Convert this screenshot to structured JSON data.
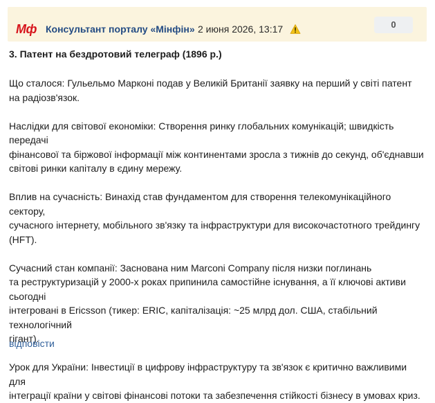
{
  "header": {
    "logo_text": "Мф",
    "author": "Консультант порталу «Мінфін»",
    "date": "2 июня 2026, 13:17",
    "counter": "0",
    "warning_icon": "warning-triangle-icon",
    "colors": {
      "header_bg": "#fbf4de",
      "logo": "#d7141c",
      "author": "#234b83",
      "warning": "#f2c219"
    }
  },
  "post": {
    "title": "3. Патент на бездротовий телеграф (1896 р.)",
    "paragraphs": [
      {
        "lines": [
          "Що сталося: Гульельмо Марконі подав у Великій Британії заявку на перший у світі патент",
          "на радіозв'язок."
        ]
      },
      {
        "lines": [
          "Наслідки для світової економіки: Створення ринку глобальних комунікацій; швидкість передачі",
          "фінансової та біржової інформації між континентами зросла з тижнів до секунд, об'єднавши",
          "світові ринки капіталу в єдину мережу."
        ]
      },
      {
        "lines": [
          "Вплив на сучасність: Винахід став фундаментом для створення телекомунікаційного сектору,",
          "сучасного інтернету, мобільного зв'язку та інфраструктури для високочастотного трейдингу",
          "(HFT)."
        ]
      },
      {
        "lines": [
          "Сучасний стан компанії: Заснована ним Marconi Company після низки поглинань",
          "та реструктуризацій у 2000-х роках припинила самостійне існування, а її ключові активи сьогодні",
          "інтегровані в Ericsson (тикер: ERIC, капіталізація: ~25 млрд дол. США, стабільний технологічний",
          "гігант)."
        ]
      },
      {
        "lines": [
          "Урок для України: Інвестиції в цифрову інфраструктуру та зв'язок є критично важливими для",
          "інтеграції країни у світові фінансові потоки та забезпечення стійкості бізнесу в умовах криз."
        ]
      }
    ],
    "reply_label": "відповісти",
    "reply_color": "#2f5f9a"
  }
}
